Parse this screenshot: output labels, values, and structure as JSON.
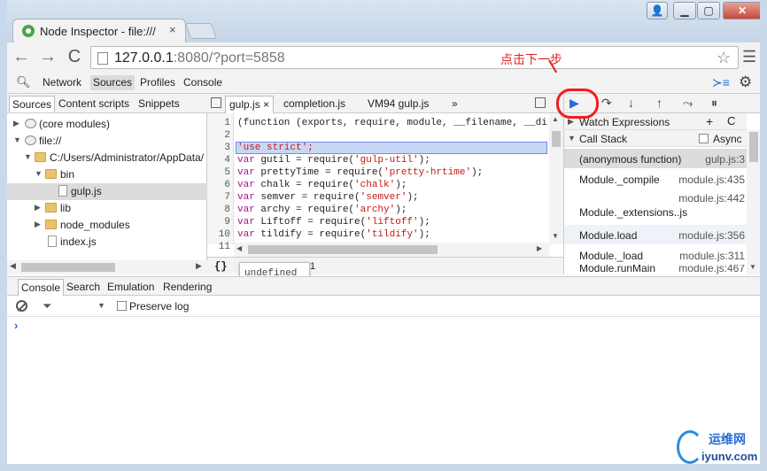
{
  "window": {
    "tab_title": "Node Inspector - file:///",
    "tab_close": "×",
    "btn_user": "👤",
    "btn_min": "▁",
    "btn_max": "▢",
    "btn_close": "✕"
  },
  "toolbar": {
    "url_host": "127.0.0.1",
    "url_rest": ":8080/?port=5858",
    "back": "←",
    "forward": "→",
    "reload": "C",
    "star": "☆",
    "menu": "☰"
  },
  "annotation": {
    "text": "点击下一步",
    "color": "#e02020"
  },
  "devtools": {
    "panels": [
      "Network",
      "Sources",
      "Profiles",
      "Console"
    ],
    "active_panel": "Sources"
  },
  "navigator": {
    "tabs": [
      "Sources",
      "Content scripts",
      "Snippets"
    ],
    "tree": [
      {
        "label": "(core modules)",
        "type": "globe",
        "arrow": "▶"
      },
      {
        "label": "file://",
        "type": "globe",
        "arrow": "▼"
      },
      {
        "label": "C:/Users/Administrator/AppData/",
        "type": "folder",
        "arrow": "▼"
      },
      {
        "label": "bin",
        "type": "folder",
        "arrow": "▼"
      },
      {
        "label": "gulp.js",
        "type": "file",
        "arrow": ""
      },
      {
        "label": "lib",
        "type": "folder",
        "arrow": "▶"
      },
      {
        "label": "node_modules",
        "type": "folder",
        "arrow": "▶"
      },
      {
        "label": "index.js",
        "type": "file",
        "arrow": ""
      }
    ]
  },
  "editor": {
    "tabs": [
      "gulp.js",
      "completion.js",
      "VM94 gulp.js",
      "»"
    ],
    "tab_close": "×",
    "lines": [
      "1",
      "2",
      "3",
      "4",
      "5",
      "6",
      "7",
      "8",
      "9",
      "10",
      "11"
    ],
    "code": {
      "l1": "(function (exports, require, module, __filename, __di",
      "l3": "'use strict';",
      "l4_kw": "var",
      "l4": " gutil = require(",
      "l4_s": "'gulp-util'",
      "l4_e": ");",
      "l5_kw": "var",
      "l5": " prettyTime = require(",
      "l5_s": "'pretty-hrtime'",
      "l5_e": ");",
      "l6_kw": "var",
      "l6": " chalk = require(",
      "l6_s": "'chalk'",
      "l6_e": ");",
      "l7_kw": "var",
      "l7": " semver = require(",
      "l7_s": "'semver'",
      "l7_e": ");",
      "l8_kw": "var",
      "l8": " archy = require(",
      "l8_s": "'archy'",
      "l8_e": ");",
      "l9_kw": "var",
      "l9": " Liftoff = require(",
      "l9_s": "'liftoff'",
      "l9_e": ");",
      "l10_kw": "var",
      "l10": " tildify = require(",
      "l10_s": "'tildify'",
      "l10_e": ");"
    },
    "pretty_print": "{}",
    "status": "1",
    "tooltip": "undefined"
  },
  "sidebar": {
    "watch_label": "Watch Expressions",
    "watch_add": "+",
    "watch_refresh": "C",
    "callstack_label": "Call Stack",
    "async_label": "Async",
    "frames": [
      {
        "fn": "(anonymous function)",
        "loc": "gulp.js:3"
      },
      {
        "fn": "Module._compile",
        "loc": "module.js:435"
      },
      {
        "fn": "Module._extensions..js",
        "loc": "module.js:442"
      },
      {
        "fn": "Module.load",
        "loc": "module.js:356"
      },
      {
        "fn": "Module._load",
        "loc": "module.js:311"
      },
      {
        "fn": "Module.runMain",
        "loc": "module.js:467"
      }
    ],
    "debug_buttons": {
      "resume": "▶",
      "step_over": "↷",
      "step_into": "↓",
      "step_out": "↑",
      "deactivate": "⤳",
      "pause": "⏸"
    }
  },
  "drawer": {
    "tabs": [
      "Console",
      "Search",
      "Emulation",
      "Rendering"
    ],
    "preserve_log": "Preserve log",
    "prompt": "›"
  },
  "watermark": {
    "top": "运维网",
    "bottom": "iyunv.com"
  }
}
